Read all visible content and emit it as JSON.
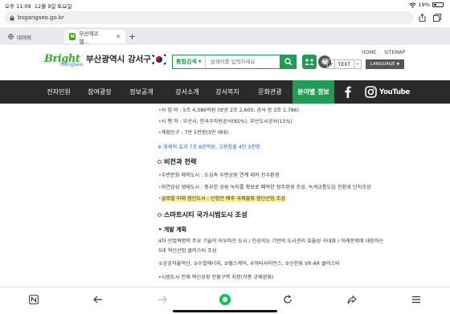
{
  "status": {
    "time": "오후 11:09",
    "date": "12월 9일 토요일",
    "battery": "19%"
  },
  "address": {
    "url": "bsgangseo.go.kr"
  },
  "tabs": [
    {
      "label": "네이버"
    },
    {
      "label": "부산에코델..."
    }
  ],
  "header": {
    "logo_bright": "Bright",
    "logo_gangseo": "Gangseo",
    "site_title": "부산광역시 강서구",
    "search_select": "통합검색",
    "search_placeholder": "검색어를 입력하세요",
    "home": "HOME",
    "sitemap": "SITEMAP",
    "text_plus": "+",
    "text_label": "TEXT",
    "text_minus": "−",
    "language": "LANGUAGE"
  },
  "nav": {
    "items": [
      "전자민원",
      "참여광장",
      "정보공개",
      "강서소개",
      "강서복지",
      "문화관광",
      "분야별 정보"
    ],
    "youtube": "YouTube"
  },
  "content": {
    "line1": "사 업 비 : 5조 4,386억원 (보상 2조 2,600, 공사 등 3조 1,786)",
    "line2": "시 행 자 : 부산시, 한국수자원공사(85%), 부산도시공사(15%)",
    "line3": "계획인구 : 7만 5천명(3만 세대)",
    "economy": "※ 경제적 효과 7조 8천억원, 고용창출 4만 3천명",
    "vision_title": "비전과 전략",
    "vision1": "수변문화 레저도시 : 도심속 수변공원 연계 레저 친수환경",
    "vision2": "자연감성 생태도시 : 풍부한 공원 녹지를 확보로 폐적한 정주환경 조성, 녹색교통도입 친환경 단지조성",
    "vision3": "글로벌 미래 첨단도시 : 신항만 배후 국제물류 첨단산업 조성",
    "smart_title": "스마트시티 국가시범도시 조성",
    "dev_title": "개발 계획",
    "dev_desc1": "4차 산업혁명의 주요 기술이 어우러진 도시 / 인공지능 기반의 도시관리 효율성 극대화 / 미래문제에 대응하는",
    "dev_desc2": "5대 혁신산업 클러스터 조성",
    "clusters": "①공공자율혁신, ②수열에너지, ③헬스케어, ④워터사이언스, ⑤신한류 VR·AR 클러스터",
    "pilot": "•시범도시 전체 혁신성장 진흥구역 지정(각종 규제완화)"
  },
  "colors": {
    "accent": "#239b56",
    "nav_bg": "#2a2a2a",
    "red": "#e03b2f",
    "blue": "#2563c9"
  }
}
